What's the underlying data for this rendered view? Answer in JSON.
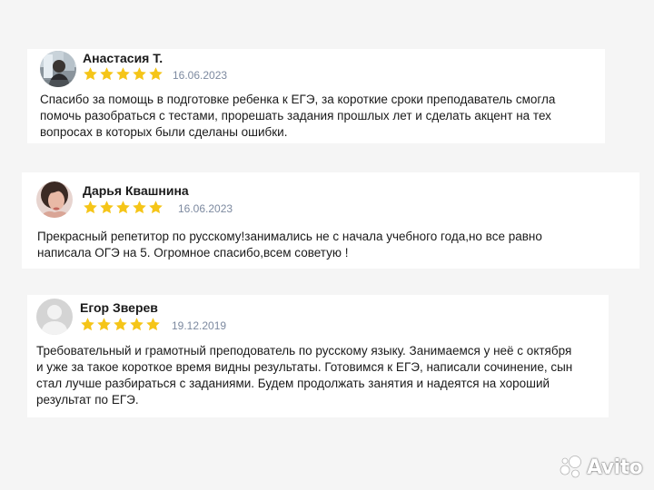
{
  "colors": {
    "page_background": "#f5f5f5",
    "card_background": "#ffffff",
    "star": "#f5c518",
    "date_text": "#7d8aa0"
  },
  "reviews": [
    {
      "author": "Анастасия Т.",
      "avatar": "photo-avatar",
      "rating": 5,
      "max_rating": 5,
      "date": "16.06.2023",
      "text": "Спасибо за помощь в подготовке ребенка к ЕГЭ, за короткие сроки преподаватель смогла\nпомочь разобраться с тестами, прорешать задания прошлых лет и сделать акцент на тех\nвопросах в которых были сделаны ошибки."
    },
    {
      "author": "Дарья Квашнина",
      "avatar": "photo-avatar",
      "rating": 5,
      "max_rating": 5,
      "date": "16.06.2023",
      "text": "Прекрасный репетитор по русскому!занимались не с начала учебного года,но все равно\nнаписала ОГЭ на 5. Огромное спасибо,всем советую !"
    },
    {
      "author": "Егор Зверев",
      "avatar": "default-user-avatar",
      "rating": 5,
      "max_rating": 5,
      "date": "19.12.2019",
      "text": "Требовательный и грамотный преподователь по русскому языку. Занимаемся у неё с октября\nи уже за такое короткое время видны результаты. Готовимся к ЕГЭ, написали сочинение, сын\nстал лучше разбираться с заданиями. Будем продолжать занятия и надеятся на хороший\nрезультат по ЕГЭ."
    }
  ],
  "watermark": {
    "brand": "Avito",
    "icon": "avito-logo-icon"
  }
}
